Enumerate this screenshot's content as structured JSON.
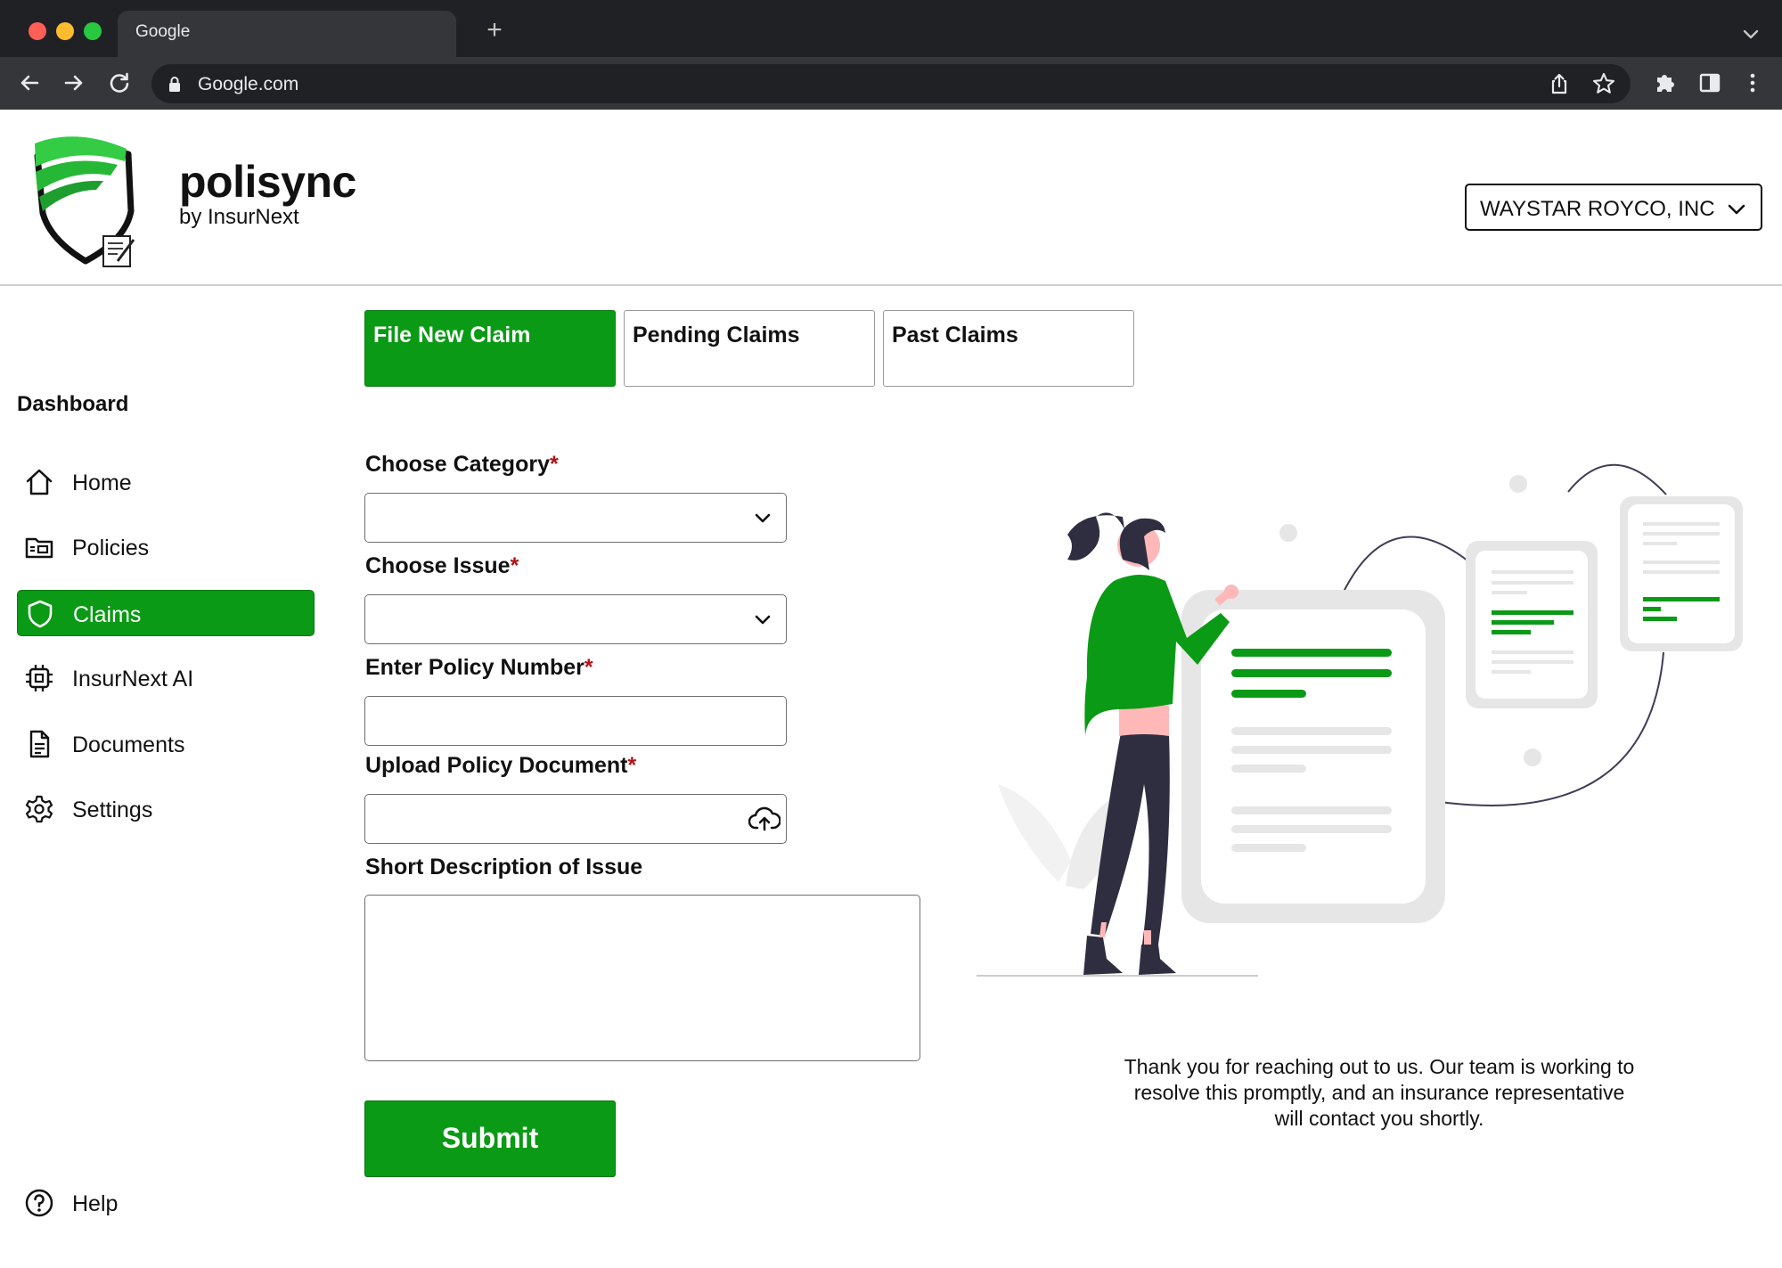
{
  "browser": {
    "tab_title": "Google",
    "url": "Google.com",
    "dots": [
      "#ff5f57",
      "#febc2e",
      "#28c840"
    ]
  },
  "brand": {
    "name": "polisync",
    "sub": "by InsurNext",
    "accent": "#0a9a15"
  },
  "company": {
    "selected": "WAYSTAR ROYCO, INC"
  },
  "sidebar": {
    "title": "Dashboard",
    "items": [
      {
        "label": "Home",
        "icon": "home-icon"
      },
      {
        "label": "Policies",
        "icon": "folder-icon"
      },
      {
        "label": "Claims",
        "icon": "shield-icon",
        "active": true
      },
      {
        "label": "InsurNext AI",
        "icon": "chip-icon"
      },
      {
        "label": "Documents",
        "icon": "document-icon"
      },
      {
        "label": "Settings",
        "icon": "gear-icon"
      }
    ],
    "help": {
      "label": "Help",
      "icon": "help-icon"
    }
  },
  "tabs": [
    {
      "label": "File New Claim",
      "active": true
    },
    {
      "label": "Pending Claims"
    },
    {
      "label": "Past Claims"
    }
  ],
  "form": {
    "category_label": "Choose Category",
    "issue_label": "Choose Issue",
    "policy_label": "Enter Policy Number",
    "upload_label": "Upload Policy Document",
    "description_label": "Short Description of Issue",
    "required_mark": "*",
    "category_value": "",
    "issue_value": "",
    "policy_value": "",
    "description_value": "",
    "submit_label": "Submit"
  },
  "message": "Thank you for reaching out to us. Our team is working to resolve this promptly, and an insurance representative will contact you shortly."
}
